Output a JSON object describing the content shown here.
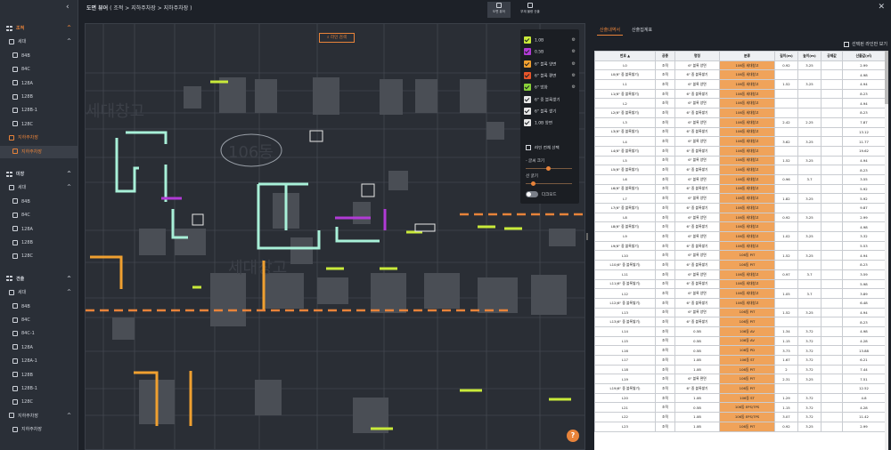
{
  "header": {
    "title_main": "도면 뷰어",
    "title_path": "( 조적 > 지하주차장 > 지하주차장 )",
    "btn_drawing_view": "도면 뷰어",
    "btn_member_info": "부재 물량 산출",
    "collapse_icon": "chevron-left-icon",
    "close_icon": "close-icon"
  },
  "sidebar": {
    "items": [
      {
        "label": "조적",
        "level": 0,
        "orange": true
      },
      {
        "label": "세대",
        "level": 1
      },
      {
        "label": "84B",
        "level": 2
      },
      {
        "label": "84C",
        "level": 2
      },
      {
        "label": "128A",
        "level": 2
      },
      {
        "label": "128B",
        "level": 2
      },
      {
        "label": "128B-1",
        "level": 2
      },
      {
        "label": "128C",
        "level": 2
      },
      {
        "label": "지하주차장",
        "level": 1,
        "orange": true
      },
      {
        "label": "지하주차장",
        "level": 2,
        "orange": true,
        "selected": true
      },
      {
        "label": "미장",
        "level": 0
      },
      {
        "label": "세대",
        "level": 1
      },
      {
        "label": "84B",
        "level": 2
      },
      {
        "label": "84C",
        "level": 2
      },
      {
        "label": "128A",
        "level": 2
      },
      {
        "label": "128B",
        "level": 2
      },
      {
        "label": "128C",
        "level": 2
      },
      {
        "label": "견출",
        "level": 0
      },
      {
        "label": "세대",
        "level": 1
      },
      {
        "label": "84B",
        "level": 2
      },
      {
        "label": "84C",
        "level": 2
      },
      {
        "label": "84C-1",
        "level": 2
      },
      {
        "label": "128A",
        "level": 2
      },
      {
        "label": "128A-1",
        "level": 2
      },
      {
        "label": "128B",
        "level": 2
      },
      {
        "label": "128B-1",
        "level": 2
      },
      {
        "label": "128C",
        "level": 2
      },
      {
        "label": "지하주차장",
        "level": 1
      },
      {
        "label": "지하주차장",
        "level": 2
      }
    ]
  },
  "drawing": {
    "search_label": "라인 검색",
    "texts": [
      "세대창고",
      "106동",
      "세대창고"
    ],
    "help_label": "?"
  },
  "layers": {
    "items": [
      {
        "label": "1.0B",
        "color": "#c9ea3a"
      },
      {
        "label": "0.5B",
        "color": "#b13bd6"
      },
      {
        "label": "6\" 블록 양면",
        "color": "#f0a030"
      },
      {
        "label": "6\" 블록 편면",
        "color": "#e8552a"
      },
      {
        "label": "6\" 방화",
        "color": "#8ad23a"
      },
      {
        "label": "6\" 중 블록쌓기",
        "color": "#e8e8e8"
      },
      {
        "label": "6\" 블록 쌓기",
        "color": "#e8e8e8"
      },
      {
        "label": "1.0B 양면",
        "color": "#e8e8e8"
      }
    ],
    "select_all": "라인 전체 선택",
    "font_size": "- 글씨 크기",
    "line_width": "선 굵기",
    "dark_mode": "다크모드",
    "font_size_level": 0.45,
    "line_width_level": 0.12
  },
  "rpanel": {
    "tab1": "산출내역서",
    "tab2": "산출집계표",
    "show_selected": "선택된 라인만 보기",
    "columns": [
      "번호 ▲",
      "공종",
      "명칭",
      "분류",
      "길이(m)",
      "높이(m)",
      "공제값",
      "산출값(㎡)"
    ],
    "rows": [
      [
        "L0",
        "조적",
        "6\" 블록 양면",
        "106동 세대창고",
        "0.92",
        "3.25",
        "",
        "2.99"
      ],
      [
        "L0(6\" 중 블록쌓기)",
        "조적",
        "6\" 중 블록쌓기",
        "106동 세대창고",
        "",
        "",
        "",
        "4.98"
      ],
      [
        "L1",
        "조적",
        "6\" 블록 양면",
        "106동 세대창고",
        "1.52",
        "3.25",
        "",
        "4.94"
      ],
      [
        "L1(6\" 중 블록쌓기)",
        "조적",
        "6\" 중 블록쌓기",
        "106동 세대창고",
        "",
        "",
        "",
        "8.23"
      ],
      [
        "L2",
        "조적",
        "6\" 블록 양면",
        "106동 세대창고",
        "",
        "",
        "",
        "4.94"
      ],
      [
        "L2(6\" 중 블록쌓기)",
        "조적",
        "6\" 중 블록쌓기",
        "106동 세대창고",
        "",
        "",
        "",
        "8.23"
      ],
      [
        "L3",
        "조적",
        "6\" 블록 양면",
        "106동 세대창고",
        "2.42",
        "2.25",
        "",
        "7.87"
      ],
      [
        "L3(6\" 중 블록쌓기)",
        "조적",
        "6\" 중 블록쌓기",
        "106동 세대창고",
        "",
        "",
        "",
        "13.12"
      ],
      [
        "L4",
        "조적",
        "6\" 블록 양면",
        "106동 세대창고",
        "3.62",
        "3.25",
        "",
        "11.77"
      ],
      [
        "L4(6\" 중 블록쌓기)",
        "조적",
        "6\" 중 블록쌓기",
        "106동 세대창고",
        "",
        "",
        "",
        "19.62"
      ],
      [
        "L5",
        "조적",
        "6\" 블록 양면",
        "106동 세대창고",
        "1.52",
        "3.25",
        "",
        "4.94"
      ],
      [
        "L5(6\" 중 블록쌓기)",
        "조적",
        "6\" 중 블록쌓기",
        "106동 세대창고",
        "",
        "",
        "",
        "8.23"
      ],
      [
        "L6",
        "조적",
        "6\" 블록 양면",
        "106동 세대창고",
        "0.96",
        "3.7",
        "",
        "3.55"
      ],
      [
        "L6(6\" 중 블록쌓기)",
        "조적",
        "6\" 중 블록쌓기",
        "106동 세대창고",
        "",
        "",
        "",
        "5.92"
      ],
      [
        "L7",
        "조적",
        "6\" 블록 양면",
        "106동 세대창고",
        "1.82",
        "3.25",
        "",
        "5.92"
      ],
      [
        "L7(6\" 중 블록쌓기)",
        "조적",
        "6\" 중 블록쌓기",
        "106동 세대창고",
        "",
        "",
        "",
        "9.87"
      ],
      [
        "L8",
        "조적",
        "6\" 블록 양면",
        "106동 세대창고",
        "0.92",
        "3.25",
        "",
        "2.99"
      ],
      [
        "L8(6\" 중 블록쌓기)",
        "조적",
        "6\" 중 블록쌓기",
        "106동 세대창고",
        "",
        "",
        "",
        "4.98"
      ],
      [
        "L9",
        "조적",
        "6\" 블록 양면",
        "106동 세대창고",
        "1.02",
        "3.25",
        "",
        "3.32"
      ],
      [
        "L9(6\" 중 블록쌓기)",
        "조적",
        "6\" 중 블록쌓기",
        "106동 세대창고",
        "",
        "",
        "",
        "5.53"
      ],
      [
        "L10",
        "조적",
        "6\" 블록 양면",
        "106동 PIT",
        "1.52",
        "3.25",
        "",
        "4.94"
      ],
      [
        "L10(6\" 중 블록쌓기)",
        "조적",
        "6\" 중 블록쌓기",
        "106동 PIT",
        "",
        "",
        "",
        "8.23"
      ],
      [
        "L11",
        "조적",
        "6\" 블록 양면",
        "106동 세대창고",
        "0.97",
        "3.7",
        "",
        "3.59"
      ],
      [
        "L11(6\" 중 블록쌓기)",
        "조적",
        "6\" 중 블록쌓기",
        "106동 세대창고",
        "",
        "",
        "",
        "5.98"
      ],
      [
        "L12",
        "조적",
        "6\" 블록 양면",
        "106동 세대창고",
        "1.05",
        "3.7",
        "",
        "3.89"
      ],
      [
        "L12(6\" 중 블록쌓기)",
        "조적",
        "6\" 중 블록쌓기",
        "106동 세대창고",
        "",
        "",
        "",
        "6.48"
      ],
      [
        "L13",
        "조적",
        "6\" 블록 양면",
        "106동 PIT",
        "1.52",
        "3.25",
        "",
        "4.94"
      ],
      [
        "L13(6\" 중 블록쌓기)",
        "조적",
        "6\" 중 블록쌓기",
        "106동 PIT",
        "",
        "",
        "",
        "8.23"
      ],
      [
        "L14",
        "조적",
        "0.5B",
        "106동 AV",
        "1.34",
        "3.72",
        "",
        "4.98"
      ],
      [
        "L15",
        "조적",
        "0.5B",
        "106동 AV",
        "1.15",
        "3.72",
        "",
        "4.28"
      ],
      [
        "L16",
        "조적",
        "0.5B",
        "106동 PD",
        "3.73",
        "3.72",
        "",
        "13.88"
      ],
      [
        "L17",
        "조적",
        "1.0B",
        "106동 ST",
        "1.67",
        "3.72",
        "",
        "6.21"
      ],
      [
        "L18",
        "조적",
        "1.0B",
        "106동 PIT",
        "2",
        "3.72",
        "",
        "7.44"
      ],
      [
        "L19",
        "조적",
        "6\" 블록 편면",
        "106동 PIT",
        "2.31",
        "3.25",
        "",
        "7.51"
      ],
      [
        "L19(6\" 중 블록쌓기)",
        "조적",
        "6\" 중 블록쌓기",
        "106동 PIT",
        "",
        "",
        "",
        "12.52"
      ],
      [
        "L20",
        "조적",
        "1.0B",
        "106동 ST",
        "1.29",
        "3.72",
        "",
        "4.8"
      ],
      [
        "L21",
        "조적",
        "0.5B",
        "106동 EPS/TPS",
        "1.15",
        "3.72",
        "",
        "4.28"
      ],
      [
        "L22",
        "조적",
        "1.0B",
        "106동 EPS/TPS",
        "3.07",
        "3.72",
        "",
        "11.42"
      ],
      [
        "L23",
        "조적",
        "1.0B",
        "106동 PIT",
        "0.92",
        "3.25",
        "",
        "2.99"
      ]
    ],
    "orange_col": 3
  }
}
